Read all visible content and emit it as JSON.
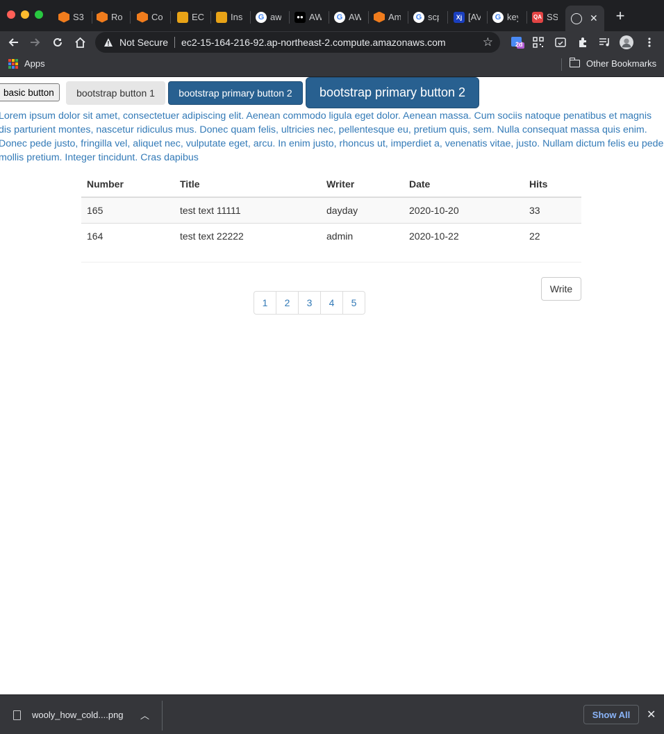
{
  "browser": {
    "tabs": [
      {
        "label": "S3",
        "icon": "aws-orange-cube-icon"
      },
      {
        "label": "Ro",
        "icon": "aws-orange-cube-icon"
      },
      {
        "label": "Co",
        "icon": "aws-orange-cube-icon"
      },
      {
        "label": "EC",
        "icon": "aws-gold-box-icon"
      },
      {
        "label": "Ins",
        "icon": "aws-gold-box-icon"
      },
      {
        "label": "aw",
        "icon": "google-icon"
      },
      {
        "label": "AW",
        "icon": "medium-icon"
      },
      {
        "label": "AW",
        "icon": "google-icon"
      },
      {
        "label": "Am",
        "icon": "aws-orange-cube-icon"
      },
      {
        "label": "scp",
        "icon": "google-icon"
      },
      {
        "label": "[AV",
        "icon": "blue-site-icon"
      },
      {
        "label": "key",
        "icon": "google-icon"
      },
      {
        "label": "SS",
        "icon": "qa-icon"
      }
    ],
    "security_status": "Not Secure",
    "url": "ec2-15-164-216-92.ap-northeast-2.compute.amazonaws.com",
    "extension_badge": "2d",
    "bookmarks": {
      "apps_label": "Apps",
      "other_label": "Other Bookmarks"
    }
  },
  "page": {
    "buttons": {
      "basic": "basic button",
      "default": "bootstrap button 1",
      "primary": "bootstrap primary button 2",
      "primary_large": "bootstrap primary button 2"
    },
    "lorem": "Lorem ipsum dolor sit amet, consectetuer adipiscing elit. Aenean commodo ligula eget dolor. Aenean massa. Cum sociis natoque penatibus et magnis dis parturient montes, nascetur ridiculus mus. Donec quam felis, ultricies nec, pellentesque eu, pretium quis, sem. Nulla consequat massa quis enim. Donec pede justo, fringilla vel, aliquet nec, vulputate eget, arcu. In enim justo, rhoncus ut, imperdiet a, venenatis vitae, justo. Nullam dictum felis eu pede mollis pretium. Integer tincidunt. Cras dapibus",
    "table": {
      "headers": [
        "Number",
        "Title",
        "Writer",
        "Date",
        "Hits"
      ],
      "rows": [
        [
          "165",
          "test text 11111",
          "dayday",
          "2020-10-20",
          "33"
        ],
        [
          "164",
          "test text 22222",
          "admin",
          "2020-10-22",
          "22"
        ]
      ]
    },
    "write_label": "Write",
    "pages": [
      "1",
      "2",
      "3",
      "4",
      "5"
    ]
  },
  "downloads": {
    "file_name": "wooly_how_cold....png",
    "show_all": "Show All"
  },
  "colors": {
    "link": "#337ab7",
    "primary": "#286090",
    "chrome_dark": "#35363a"
  }
}
